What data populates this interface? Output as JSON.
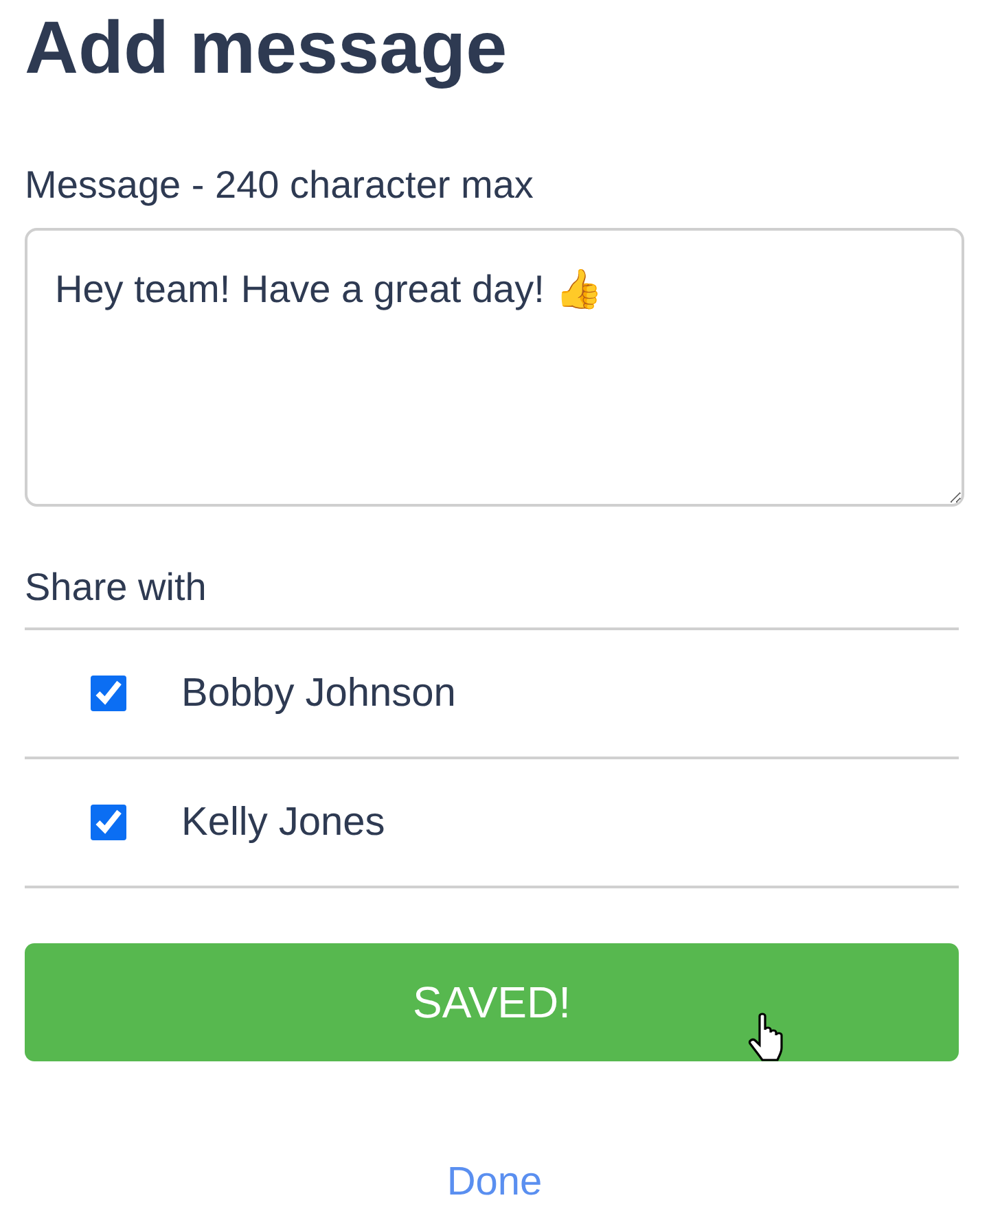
{
  "title": "Add message",
  "message": {
    "label": "Message - 240 character max",
    "value": "Hey team! Have a great day! 👍"
  },
  "share": {
    "label": "Share with",
    "people": [
      {
        "name": "Bobby Johnson",
        "checked": true
      },
      {
        "name": "Kelly Jones",
        "checked": true
      }
    ]
  },
  "save_button": {
    "label": "SAVED!"
  },
  "done_link": {
    "label": "Done"
  }
}
